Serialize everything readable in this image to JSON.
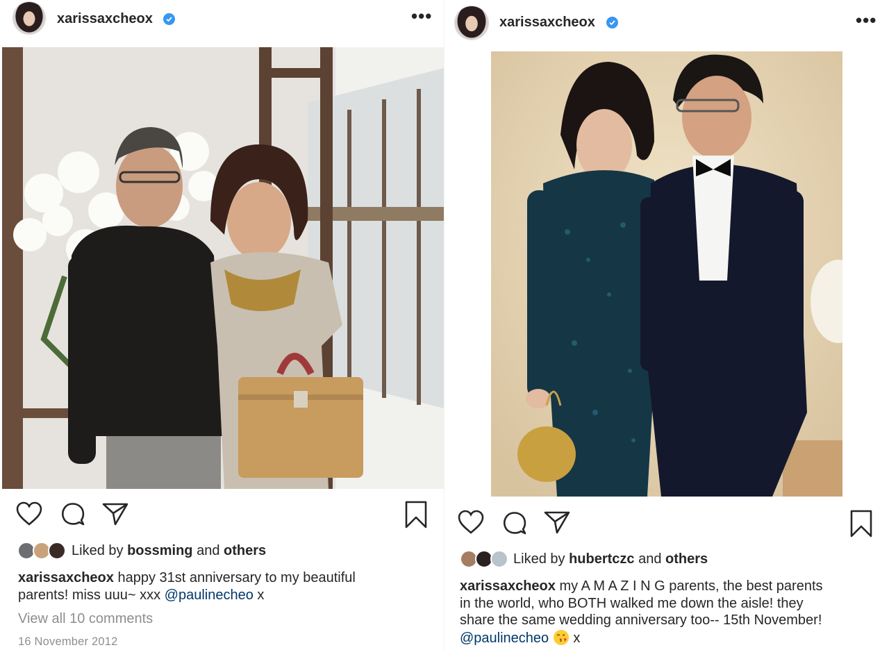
{
  "posts": [
    {
      "username": "xarissaxcheox",
      "photo_alt": "photo",
      "liked_by_prefix": "Liked by",
      "liked_by_user": "bossming",
      "liked_by_and": "and",
      "liked_by_others": "others",
      "caption_user": "xarissaxcheox",
      "caption_line1": "happy 31st anniversary to my beautiful",
      "caption_line2": "parents! miss uuu~ xxx",
      "caption_mention": "@paulinecheo",
      "caption_tail": "x",
      "view_comments": "View all 10 comments",
      "date": "16 November 2012"
    },
    {
      "username": "xarissaxcheox",
      "liked_by_prefix": "Liked by",
      "liked_by_user": "hubertczc",
      "liked_by_and": "and",
      "liked_by_others": "others",
      "caption_user": "xarissaxcheox",
      "caption_line1": "my A M A Z I N G parents, the best parents",
      "caption_line2": "in the world, who BOTH walked me down the aisle! they",
      "caption_line3": "share the same wedding anniversary too-- 15th November!",
      "caption_mention": "@paulinecheo",
      "caption_tail": "x"
    }
  ],
  "icons": {
    "verified": "verified-badge-icon",
    "more": "more-options-icon",
    "like": "heart-icon",
    "comment": "comment-bubble-icon",
    "share": "paper-plane-icon",
    "save": "bookmark-icon",
    "emoji": "face-blowing-kiss-emoji"
  },
  "colors": {
    "verified_blue": "#3897f0",
    "mention_blue": "#00376b",
    "muted_gray": "#8e8e8e",
    "text": "#262626"
  }
}
